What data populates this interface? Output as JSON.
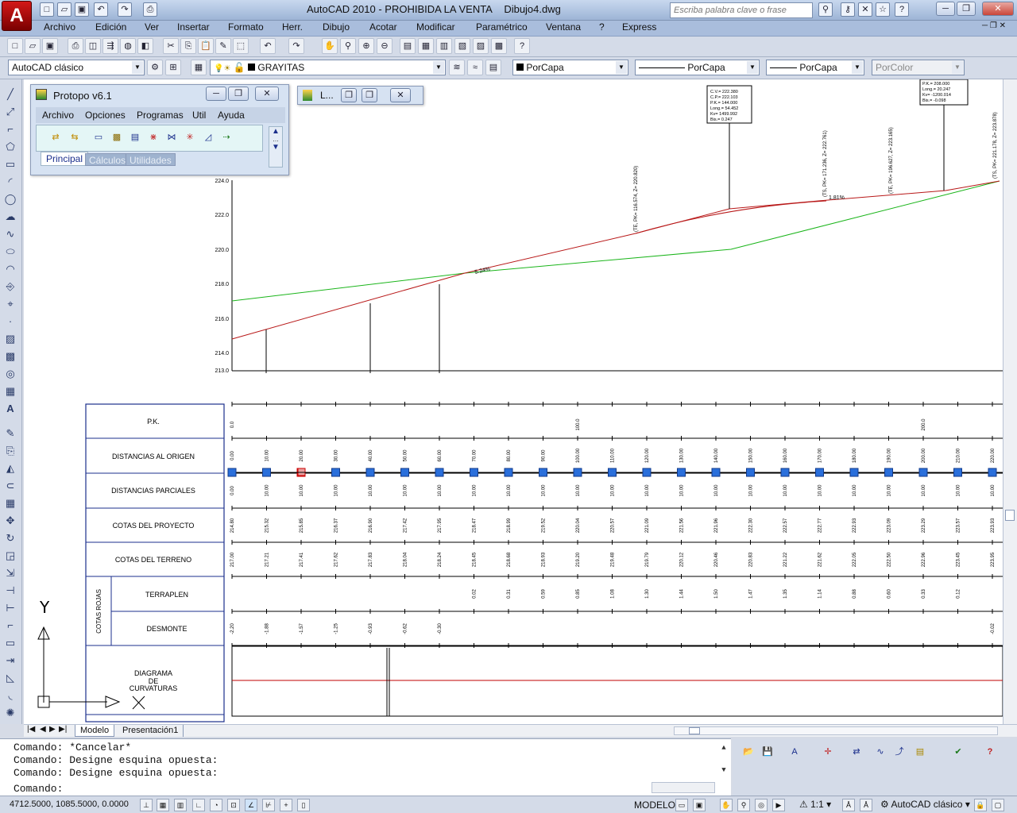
{
  "window": {
    "title": "AutoCAD 2010 - PROHIBIDA LA VENTA",
    "document": "Dibujo4.dwg",
    "help_placeholder": "Escriba palabra clave o frase"
  },
  "menu": [
    "Archivo",
    "Edición",
    "Ver",
    "Insertar",
    "Formato",
    "Herr.",
    "Dibujo",
    "Acotar",
    "Modificar",
    "Paramétrico",
    "Ventana",
    "?",
    "Express"
  ],
  "properties_toolbar": {
    "workspace": "AutoCAD clásico",
    "layer": "GRAYITAS",
    "color": "PorCapa",
    "linetype": "PorCapa",
    "lineweight": "PorCapa",
    "plotstyle": "PorColor"
  },
  "protopo": {
    "title": "Protopo v6.1",
    "menu": [
      "Archivo",
      "Opciones",
      "Programas",
      "Util",
      "Ayuda"
    ],
    "tabs": [
      "Principal",
      "Cálculos",
      "Utilidades"
    ],
    "mini_title": "L..."
  },
  "profile": {
    "y_axis_labels": [
      "224.0",
      "222.0",
      "220.0",
      "218.0",
      "216.0",
      "214.0",
      "213.0"
    ],
    "slope_label_1": "5.24%",
    "slope_label_2": "1.81%",
    "vertical_labels": [
      "(TE, PK= 116.574, Z= 220.820)",
      "(TS, PK= 171.236, Z= 222.761)",
      "(TE, PK= 196.627, Z= 223.165)",
      "(TS, PK= 221.178, Z= 223.878)"
    ],
    "curve_box_1": [
      "C.V.= 222.380",
      "C.P.= 222.103",
      "P.K.= 144.000",
      "Long.= 54.452",
      "Kv= 1499.992",
      "Bis.= 0.247"
    ],
    "curve_box_2": [
      "P.K.= 208.000",
      "Long.= 20.247",
      "Kv= -1200.014",
      "Bis.= -0.098"
    ]
  },
  "guitar": {
    "rows": [
      "P.K.",
      "DISTANCIAS AL ORIGEN",
      "DISTANCIAS PARCIALES",
      "COTAS DEL PROYECTO",
      "COTAS DEL TERRENO",
      "TERRAPLEN",
      "DESMONTE",
      "DIAGRAMA DE CURVATURAS"
    ],
    "group_label": "COTAS ROJAS",
    "pk_values": [
      "0.0",
      "100.0",
      "200.0"
    ],
    "distances_origin": [
      "0.00",
      "10.00",
      "20.00",
      "30.00",
      "40.00",
      "50.00",
      "60.00",
      "70.00",
      "80.00",
      "90.00",
      "100.00",
      "110.00",
      "120.00",
      "130.00",
      "140.00",
      "150.00",
      "160.00",
      "170.00",
      "180.00",
      "190.00",
      "200.00",
      "210.00",
      "220.00"
    ],
    "distances_partial": [
      "0.00",
      "10.00",
      "10.00",
      "10.00",
      "10.00",
      "10.00",
      "10.00",
      "10.00",
      "10.00",
      "10.00",
      "10.00",
      "10.00",
      "10.00",
      "10.00",
      "10.00",
      "10.00",
      "10.00",
      "10.00",
      "10.00",
      "10.00",
      "10.00",
      "10.00",
      "10.00"
    ],
    "cotas_proyecto": [
      "214.80",
      "215.32",
      "215.85",
      "216.37",
      "216.90",
      "217.42",
      "217.95",
      "218.47",
      "218.99",
      "219.52",
      "220.04",
      "220.57",
      "221.09",
      "221.56",
      "221.96",
      "222.30",
      "222.57",
      "222.77",
      "222.93",
      "223.09",
      "223.29",
      "223.57",
      "223.93"
    ],
    "cotas_terreno": [
      "217.00",
      "217.21",
      "217.41",
      "217.62",
      "217.83",
      "218.04",
      "218.24",
      "218.45",
      "218.68",
      "218.93",
      "219.20",
      "219.48",
      "219.79",
      "220.12",
      "220.46",
      "220.83",
      "221.22",
      "221.62",
      "222.05",
      "222.50",
      "222.96",
      "223.45",
      "223.95"
    ],
    "terraplen": [
      "",
      "",
      "",
      "",
      "",
      "",
      "",
      "0.02",
      "0.31",
      "0.59",
      "0.85",
      "1.08",
      "1.30",
      "1.44",
      "1.50",
      "1.47",
      "1.35",
      "1.14",
      "0.88",
      "0.60",
      "0.33",
      "0.12",
      ""
    ],
    "desmonte": [
      "-2.20",
      "-1.88",
      "-1.57",
      "-1.25",
      "-0.93",
      "-0.62",
      "-0.30",
      "",
      "",
      "",
      "",
      "",
      "",
      "",
      "",
      "",
      "",
      "",
      "",
      "",
      "",
      "",
      "-0.02"
    ]
  },
  "ucs": {
    "y": "Y"
  },
  "layout_tabs": [
    "Modelo",
    "Presentación1"
  ],
  "command_history": [
    "Comando: *Cancelar*",
    "Comando: Designe esquina opuesta:",
    "Comando: Designe esquina opuesta:"
  ],
  "command_prompt": "Comando:",
  "status": {
    "coords": "4712.5000, 1085.5000, 0.0000",
    "model": "MODELO",
    "scale": "1:1",
    "workspace": "AutoCAD clásico"
  }
}
